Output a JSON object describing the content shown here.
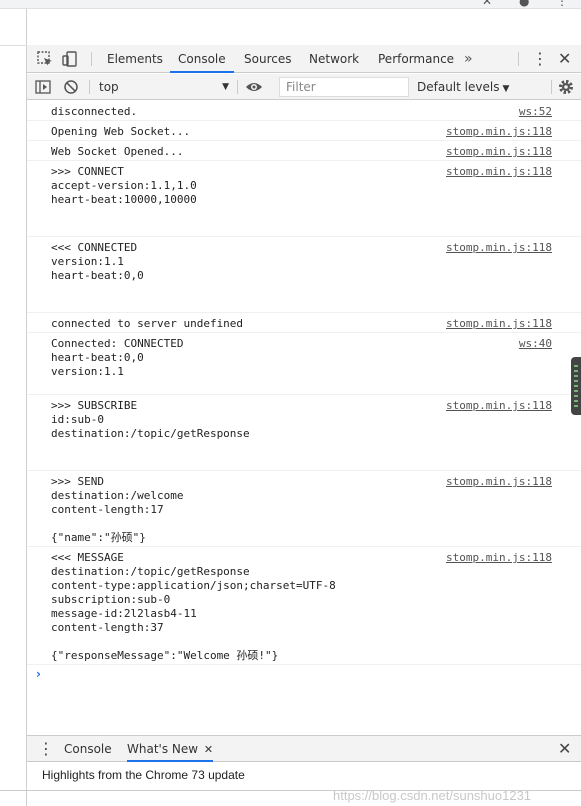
{
  "devtools": {
    "tabs": [
      {
        "label": "Elements",
        "active": false
      },
      {
        "label": "Console",
        "active": true
      },
      {
        "label": "Sources",
        "active": false
      },
      {
        "label": "Network",
        "active": false
      },
      {
        "label": "Performance",
        "active": false
      }
    ],
    "more_tabs_glyph": "»",
    "menu_glyph": "⋮",
    "close_glyph": "✕"
  },
  "toolbar": {
    "context": "top",
    "context_arrow": "▼",
    "filter_placeholder": "Filter",
    "levels_label": "Default levels",
    "levels_arrow": "▼"
  },
  "messages": [
    {
      "text": "disconnected.",
      "source": "ws:52"
    },
    {
      "text": "Opening Web Socket...",
      "source": "stomp.min.js:118"
    },
    {
      "text": "Web Socket Opened...",
      "source": "stomp.min.js:118"
    },
    {
      "text": ">>> CONNECT\naccept-version:1.1,1.0\nheart-beat:10000,10000",
      "source": "stomp.min.js:118"
    },
    {
      "text": "<<< CONNECTED\nversion:1.1\nheart-beat:0,0",
      "source": "stomp.min.js:118"
    },
    {
      "text": "connected to server undefined",
      "source": "stomp.min.js:118"
    },
    {
      "text": "Connected: CONNECTED\nheart-beat:0,0\nversion:1.1",
      "source": "ws:40"
    },
    {
      "text": ">>> SUBSCRIBE\nid:sub-0\ndestination:/topic/getResponse",
      "source": "stomp.min.js:118"
    },
    {
      "text": ">>> SEND\ndestination:/welcome\ncontent-length:17\n\n{\"name\":\"孙硕\"}",
      "source": "stomp.min.js:118"
    },
    {
      "text": "<<< MESSAGE\ndestination:/topic/getResponse\ncontent-type:application/json;charset=UTF-8\nsubscription:sub-0\nmessage-id:2l2lasb4-11\ncontent-length:37\n\n{\"responseMessage\":\"Welcome 孙硕!\"}",
      "source": "stomp.min.js:118"
    }
  ],
  "prompt_glyph": "›",
  "drawer": {
    "menu_glyph": "⋮",
    "tabs": [
      {
        "label": "Console",
        "active": false
      },
      {
        "label": "What's New",
        "active": true
      }
    ],
    "tab_close_glyph": "✕",
    "close_glyph": "✕",
    "highlight": "Highlights from the Chrome 73 update",
    "watermark": "https://blog.csdn.net/sunshuo1231"
  },
  "colors": {
    "accent": "#1a73e8",
    "toolbar_bg": "#f3f3f3",
    "link_gray": "#545454"
  }
}
